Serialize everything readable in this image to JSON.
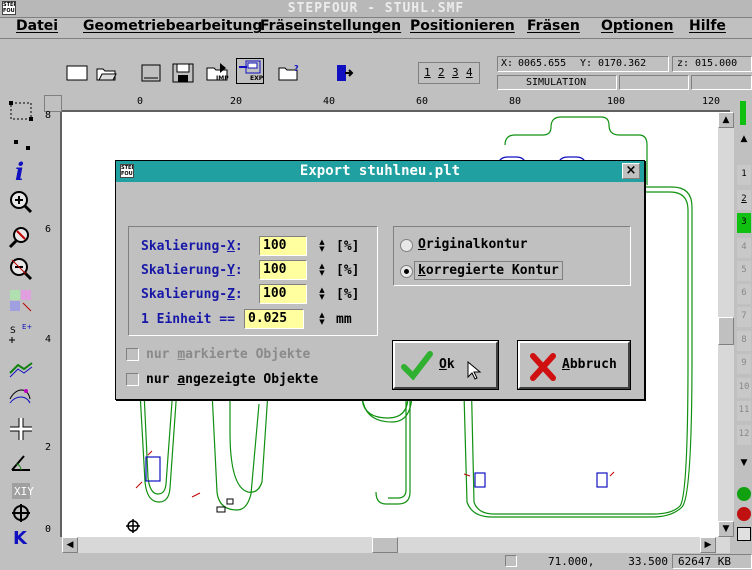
{
  "window": {
    "title": "STEPFOUR - STUHL.SMF",
    "logo": "STEP FOUR"
  },
  "menu": [
    {
      "label": "Datei"
    },
    {
      "label": "Geometriebearbeitung"
    },
    {
      "label": "Fräseinstellungen"
    },
    {
      "label": "Positionieren"
    },
    {
      "label": "Fräsen"
    },
    {
      "label": "Optionen"
    },
    {
      "label": "Hilfe"
    }
  ],
  "toolbar": {
    "layer_buttons": [
      "1",
      "2",
      "3",
      "4"
    ],
    "coords": {
      "x_label": "X:",
      "x_value": "0065.655",
      "y_label": "Y:",
      "y_value": "0170.362",
      "z_label": "z:",
      "z_value": "015.000"
    },
    "mode": "SIMULATION",
    "imp_label": "IMP",
    "exp_label": "EXP"
  },
  "ruler": {
    "top": [
      "0",
      "20",
      "40",
      "60",
      "80",
      "100",
      "120"
    ],
    "left": [
      "8",
      "6",
      "4",
      "2",
      "0"
    ]
  },
  "left_tools": [
    "select-rect-icon",
    "zoom-small-icon",
    "info-icon",
    "zoom-in-icon",
    "zoom-window-icon",
    "zoom-out-icon",
    "layers-icon",
    "origin-icon",
    "contour-icon",
    "path-icon",
    "move-icon",
    "axes-icon",
    "xyz-icon",
    "target-icon",
    "k-icon"
  ],
  "right_panel": {
    "buttons": [
      "1",
      "2",
      "3",
      "4",
      "5",
      "6",
      "7",
      "8",
      "9",
      "10",
      "11",
      "12"
    ]
  },
  "status": {
    "pos_x": "71.000,",
    "pos_y": "33.500",
    "memory": "62647 KB"
  },
  "dialog": {
    "title": "Export stuhlneu.plt",
    "close": "×",
    "fields": [
      {
        "pre": "Skalierung-",
        "key": "X",
        "post": ":",
        "value": "100",
        "unit": "[%]"
      },
      {
        "pre": "Skalierung-",
        "key": "Y",
        "post": ":",
        "value": "100",
        "unit": "[%]"
      },
      {
        "pre": "Skalierung-",
        "key": "Z",
        "post": ":",
        "value": "100",
        "unit": "[%]"
      },
      {
        "pre": "1 Einheit ==",
        "key": "",
        "post": "",
        "value": "0.025",
        "unit": "mm"
      }
    ],
    "checks": [
      {
        "pre": "nur ",
        "key": "m",
        "post": "arkierte Objekte",
        "checked": false,
        "enabled": false
      },
      {
        "pre": "nur ",
        "key": "a",
        "post": "ngezeigte Objekte",
        "checked": false,
        "enabled": true
      }
    ],
    "radios": [
      {
        "pre": "",
        "key": "O",
        "post": "riginalkontur",
        "selected": false
      },
      {
        "pre": "",
        "key": "k",
        "post": "orregierte Kontur",
        "selected": true
      }
    ],
    "ok": {
      "key": "O",
      "post": "k"
    },
    "cancel": {
      "key": "A",
      "post": "bbruch"
    }
  }
}
